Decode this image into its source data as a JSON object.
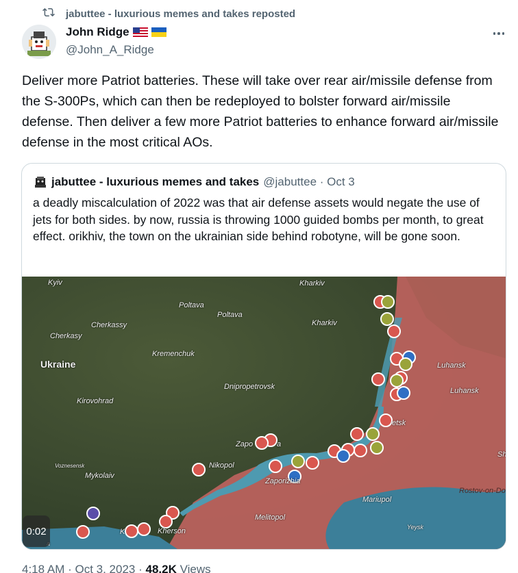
{
  "repost": {
    "text": "jabuttee - luxurious memes and takes reposted",
    "icon": "repost-icon"
  },
  "author": {
    "name": "John Ridge",
    "flags": [
      "us-flag",
      "ukraine-flag"
    ],
    "handle": "@John_A_Ridge"
  },
  "tweet": {
    "text": "Deliver more Patriot batteries. These will take over rear air/missile defense from the S-300Ps, which can then be redeployed to bolster forward air/missile defense. Then deliver a few more Patriot batteries to enhance forward air/missile defense in the most critical AOs."
  },
  "quote": {
    "name": "jabuttee - luxurious memes and takes",
    "handle": "@jabuttee",
    "date": "Oct 3",
    "meta": "@jabuttee · Oct 3",
    "text": "a deadly miscalculation of 2022 was that air defense assets would negate the use of jets for both sides. by now, russia is throwing 1000 guided bombs per month, to great effect. orikhiv, the town on the ukrainian side behind robotyne, will be gone soon.",
    "media": {
      "duration": "0:02",
      "labels": {
        "kyiv": "Kyiv",
        "kharkiv_top": "Kharkiv",
        "poltava1": "Poltava",
        "poltava2": "Poltava",
        "cherkassy1": "Cherkassy",
        "cherkasy2": "Cherkasy",
        "kharkiv2": "Kharkiv",
        "ukraine": "Ukraine",
        "kremenchuk": "Kremenchuk",
        "luhansk1": "Luhansk",
        "luhansk2": "Luhansk",
        "dnipro": "Dnipropetrovsk",
        "kirovohrad": "Kirovohrad",
        "etsk": "etsk",
        "zapo": "Zapo",
        "zapo_a": "a",
        "voznesensk": "Voznesensk",
        "nikopol": "Nikopol",
        "sh": "Sh",
        "mykolaiv": "Mykolaiv",
        "zaporizhia": "Zaporizhia",
        "rostov": "Rostov-on-Do",
        "mariupol": "Mariupol",
        "melitopol": "Melitopol",
        "kherson": "Kherson",
        "yeysk": "Yeysk",
        "k": "K",
        "a_small": "a"
      }
    }
  },
  "footer": {
    "time": "4:18 AM · Oct 3, 2023 · ",
    "views_count": "48.2K",
    "views_label": " Views"
  },
  "colors": {
    "text": "#0f1419",
    "secondary": "#536471",
    "border": "#cfd9de",
    "occupied": "#c96a66",
    "water": "#4e9ab0",
    "ua_marker": "#2f6fc4",
    "ru_marker": "#d9574f",
    "neutral_marker": "#9aa33a"
  }
}
